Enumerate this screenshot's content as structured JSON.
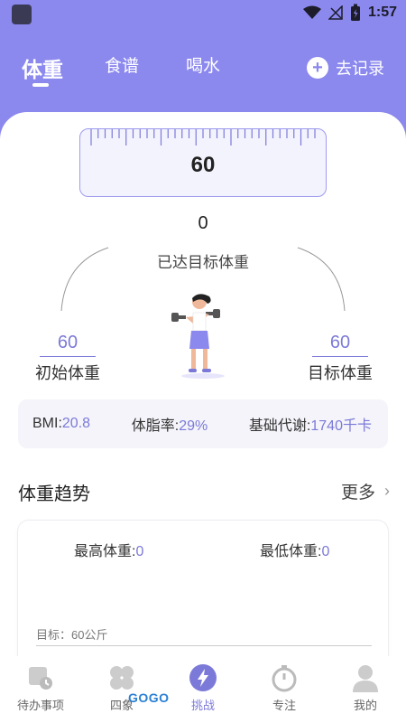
{
  "status": {
    "time": "1:57"
  },
  "tabs": [
    {
      "label": "体重",
      "active": true
    },
    {
      "label": "食谱",
      "active": false
    },
    {
      "label": "喝水",
      "active": false
    }
  ],
  "record_button": {
    "label": "去记录",
    "icon": "plus-icon"
  },
  "ruler": {
    "value": "60"
  },
  "progress": {
    "value": "0",
    "label": "已达目标体重"
  },
  "initial": {
    "value": "60",
    "label": "初始体重"
  },
  "target": {
    "value": "60",
    "label": "目标体重"
  },
  "metrics": {
    "bmi_label": "BMI:",
    "bmi_value": "20.8",
    "fat_label": "体脂率:",
    "fat_value": "29%",
    "bmr_label": "基础代谢:",
    "bmr_value": "1740千卡"
  },
  "trend": {
    "title": "体重趋势",
    "more": "更多",
    "max_label": "最高体重:",
    "max_value": "0",
    "min_label": "最低体重:",
    "min_value": "0",
    "goal_text": "目标：60公斤"
  },
  "nav": [
    {
      "label": "待办事项",
      "icon": "todo-icon"
    },
    {
      "label": "四象",
      "icon": "quadrant-icon"
    },
    {
      "label": "挑战",
      "icon": "lightning-icon",
      "active": true
    },
    {
      "label": "专注",
      "icon": "stopwatch-icon"
    },
    {
      "label": "我的",
      "icon": "user-icon"
    }
  ],
  "watermark": "GOGO",
  "colors": {
    "accent": "#8B88EE",
    "value": "#7c7ad8"
  }
}
